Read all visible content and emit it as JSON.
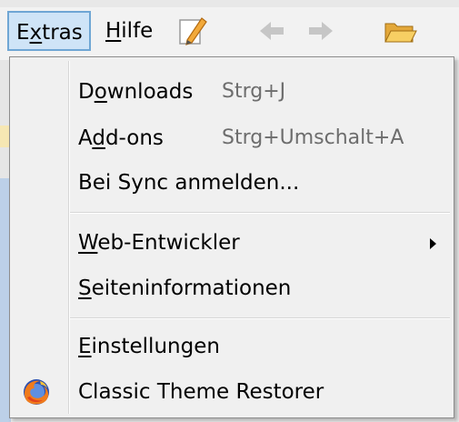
{
  "menubar": {
    "extras": {
      "pre": "E",
      "u": "x",
      "post": "tras"
    },
    "hilfe": {
      "u": "H",
      "post": "ilfe"
    },
    "icons": [
      "edit-pencil-icon",
      "back-arrow-icon",
      "forward-arrow-icon",
      "open-folder-icon"
    ]
  },
  "menu": {
    "downloads": {
      "label_pre": "D",
      "label_u": "o",
      "label_post": "wnloads",
      "shortcut": "Strg+J"
    },
    "addons": {
      "label_pre": "A",
      "label_u": "d",
      "label_post": "d-ons",
      "shortcut": "Strg+Umschalt+A"
    },
    "sync": {
      "label": "Bei Sync anmelden..."
    },
    "webdev": {
      "label_u": "W",
      "label_post": "eb-Entwickler"
    },
    "pageinfo": {
      "label_u": "S",
      "label_post": "eiteninformationen"
    },
    "settings": {
      "label_u": "E",
      "label_post": "instellungen"
    },
    "ctr": {
      "label": "Classic Theme Restorer",
      "icon": "firefox-icon"
    }
  },
  "colors": {
    "menu_bg": "#f0f0f0",
    "active_menu_bg": "#cfe4f7",
    "active_menu_border": "#6fa6d4",
    "shortcut_text": "#6d6d6d"
  }
}
